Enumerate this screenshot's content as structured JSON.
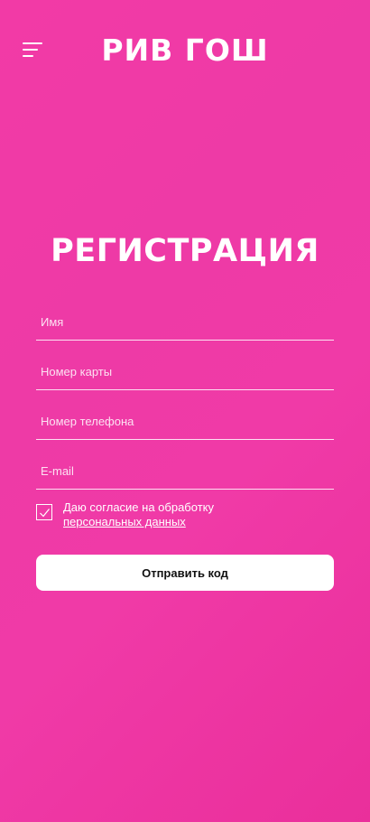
{
  "header": {
    "logo_text": "РИВ ГОШ",
    "menu_icon": "hamburger-menu-icon"
  },
  "page": {
    "title": "РЕГИСТРАЦИЯ"
  },
  "form": {
    "name_placeholder": "Имя",
    "card_placeholder": "Номер карты",
    "phone_placeholder": "Номер телефона",
    "email_placeholder": "E-mail",
    "consent_text": "Даю согласие на обработку",
    "consent_link": "персональных данных",
    "consent_checked": true,
    "submit_label": "Отправить код"
  },
  "colors": {
    "background": "#ef3aa6",
    "button_bg": "#ffffff",
    "button_text": "#111111"
  }
}
